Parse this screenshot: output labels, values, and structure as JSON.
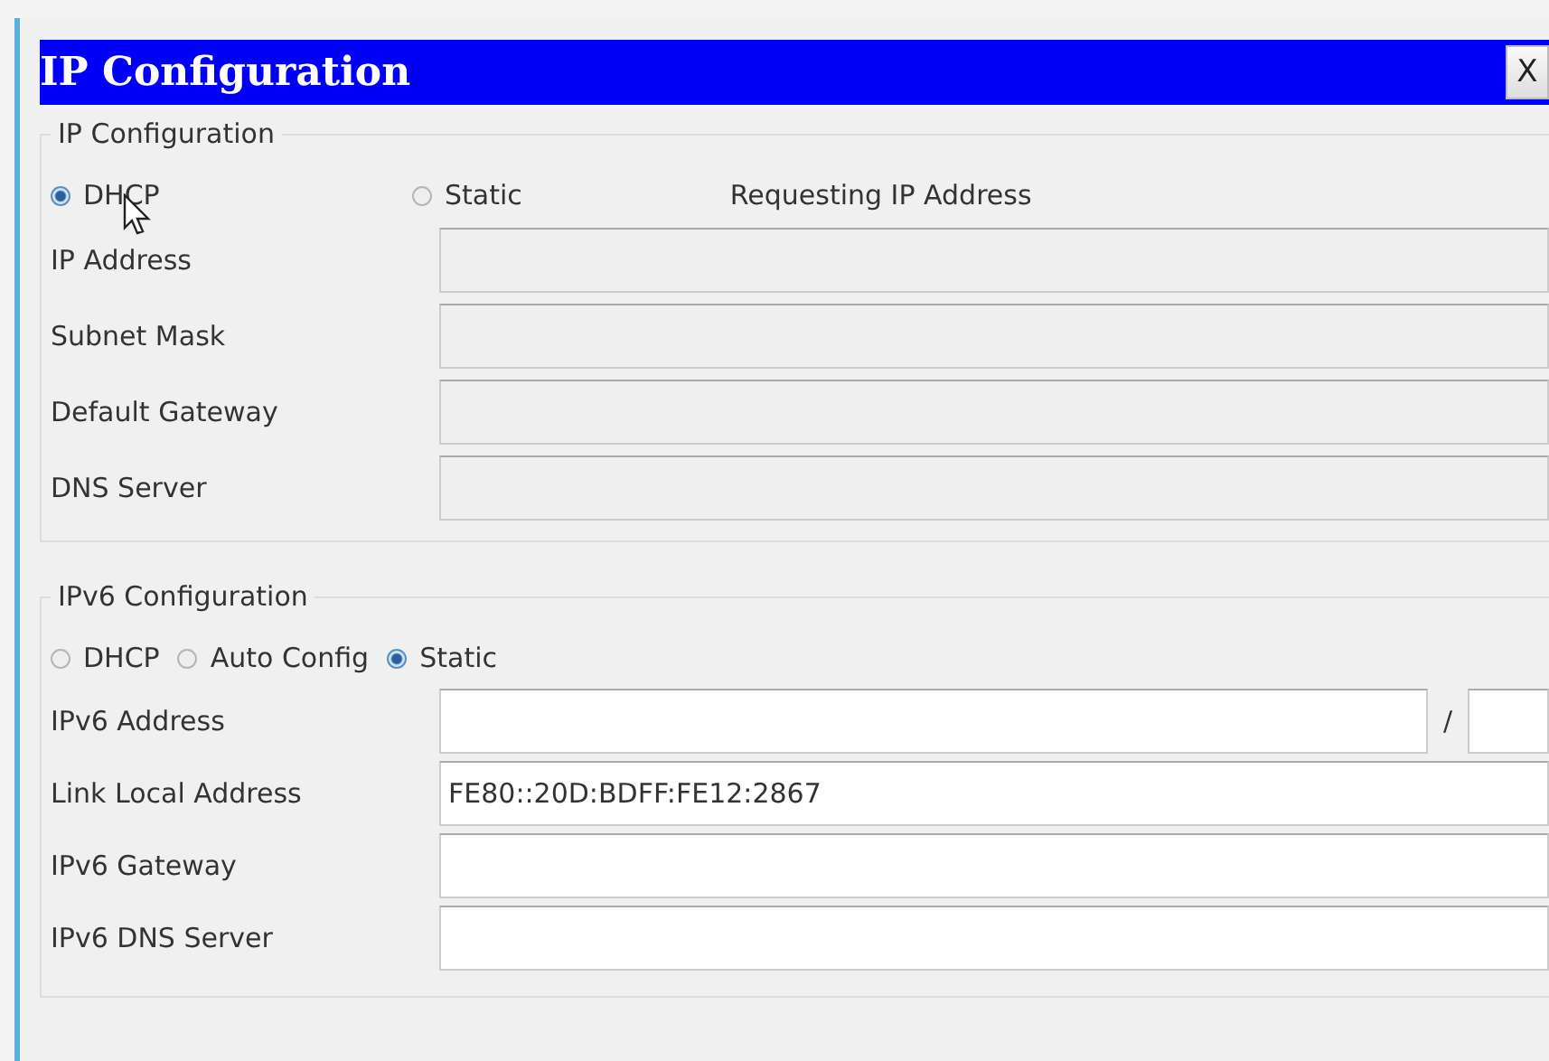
{
  "window": {
    "title": "IP Configuration",
    "close": "X"
  },
  "ipv4": {
    "legend": "IP Configuration",
    "modes": [
      {
        "label": "DHCP",
        "selected": true
      },
      {
        "label": "Static",
        "selected": false
      }
    ],
    "status": "Requesting IP Address",
    "fields": [
      {
        "label": "IP Address",
        "disabled": true
      },
      {
        "label": "Subnet Mask",
        "disabled": true
      },
      {
        "label": "Default Gateway",
        "disabled": true
      },
      {
        "label": "DNS Server",
        "disabled": true
      }
    ]
  },
  "ipv6": {
    "legend": "IPv6 Configuration",
    "modes": [
      {
        "label": "DHCP",
        "selected": false
      },
      {
        "label": "Auto Config",
        "selected": false
      },
      {
        "label": "Static",
        "selected": true
      }
    ],
    "fields": [
      {
        "label": "IPv6 Address",
        "disabled": false,
        "separator": "/"
      },
      {
        "label": "Link Local Address",
        "disabled": false,
        "value": "FE80::20D:BDFF:FE12:2867"
      },
      {
        "label": "IPv6 Gateway",
        "disabled": false
      },
      {
        "label": "IPv6 DNS Server",
        "disabled": false
      }
    ]
  }
}
